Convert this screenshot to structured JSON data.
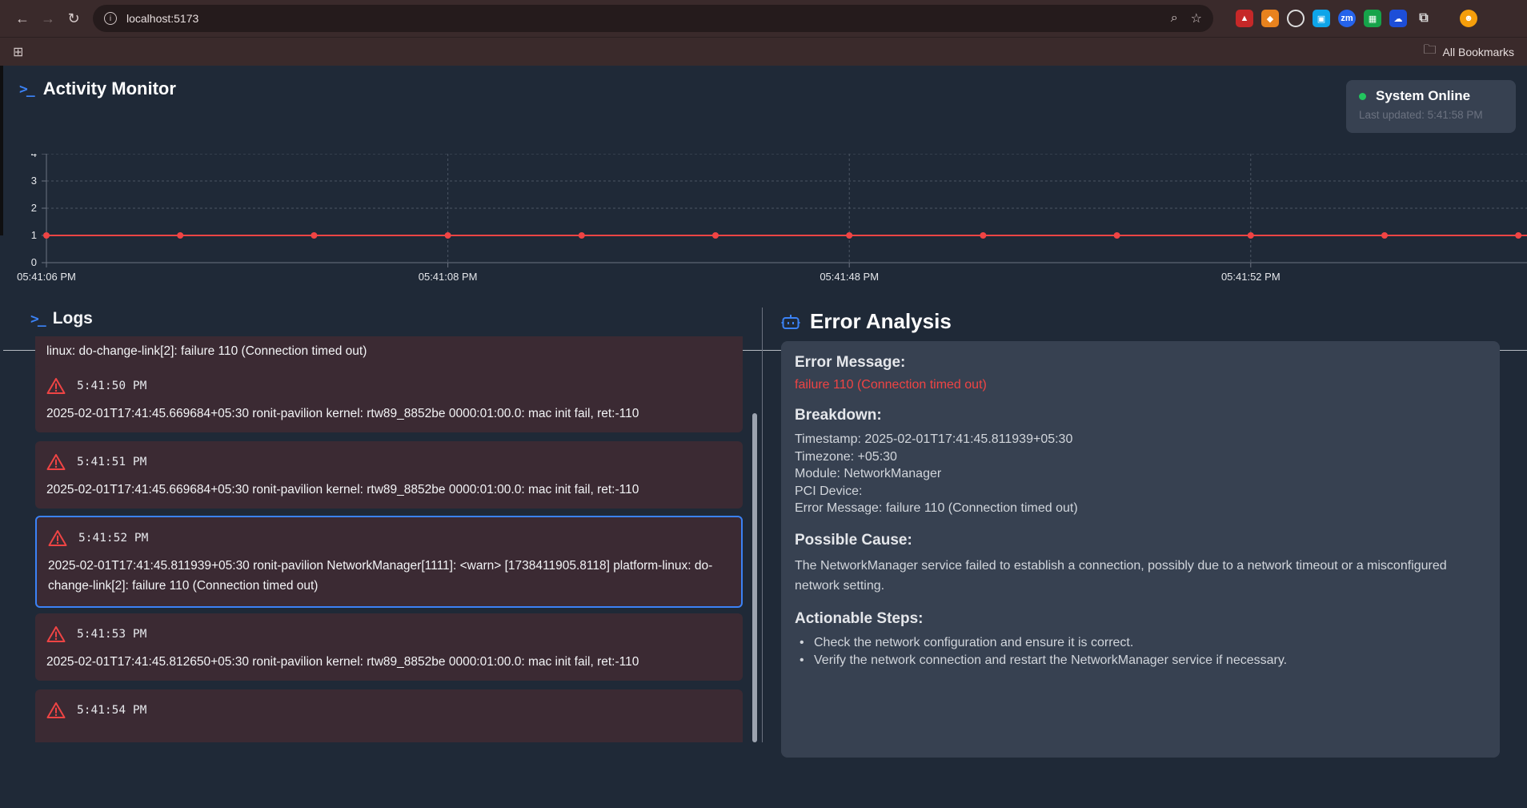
{
  "browser": {
    "url": "localhost:5173",
    "bookmarks_label": "All Bookmarks"
  },
  "app": {
    "title": "Activity Monitor",
    "status": {
      "label": "System Online",
      "last_updated": "Last updated: 5:41:58 PM",
      "color": "#22c55e"
    }
  },
  "chart_data": {
    "type": "line",
    "title": "",
    "xlabel": "",
    "ylabel": "",
    "ylim": [
      0,
      4
    ],
    "yticks": [
      0,
      1,
      2,
      3,
      4
    ],
    "x_tick_labels": [
      "05:41:06 PM",
      "05:41:08 PM",
      "05:41:48 PM",
      "05:41:52 PM"
    ],
    "grid": true,
    "series": [
      {
        "values": [
          1,
          1,
          1,
          1,
          1,
          1,
          1,
          1,
          1,
          1,
          1,
          1
        ],
        "color": "#ef4444"
      }
    ]
  },
  "logs": {
    "title": "Logs",
    "partial_top": "linux: do-change-link[2]: failure 110 (Connection timed out)",
    "items": [
      {
        "time": "5:41:50 PM",
        "message": "2025-02-01T17:41:45.669684+05:30 ronit-pavilion kernel: rtw89_8852be 0000:01:00.0: mac init fail, ret:-110"
      },
      {
        "time": "5:41:51 PM",
        "message": "2025-02-01T17:41:45.669684+05:30 ronit-pavilion kernel: rtw89_8852be 0000:01:00.0: mac init fail, ret:-110"
      },
      {
        "time": "5:41:52 PM",
        "message": "2025-02-01T17:41:45.811939+05:30 ronit-pavilion NetworkManager[1111]: <warn> [1738411905.8118] platform-linux: do-change-link[2]: failure 110 (Connection timed out)"
      },
      {
        "time": "5:41:53 PM",
        "message": "2025-02-01T17:41:45.812650+05:30 ronit-pavilion kernel: rtw89_8852be 0000:01:00.0: mac init fail, ret:-110"
      },
      {
        "time": "5:41:54 PM",
        "message": ""
      }
    ]
  },
  "analysis": {
    "title": "Error Analysis",
    "error_message_heading": "Error Message:",
    "error_message": "failure 110 (Connection timed out)",
    "breakdown_heading": "Breakdown:",
    "breakdown": [
      "Timestamp: 2025-02-01T17:41:45.811939+05:30",
      "Timezone: +05:30",
      "Module: NetworkManager",
      "PCI Device:",
      "Error Message: failure 110 (Connection timed out)"
    ],
    "cause_heading": "Possible Cause:",
    "cause": "The NetworkManager service failed to establish a connection, possibly due to a network timeout or a misconfigured network setting.",
    "steps_heading": "Actionable Steps:",
    "steps": [
      "Check the network configuration and ensure it is correct.",
      "Verify the network connection and restart the NetworkManager service if necessary."
    ]
  }
}
